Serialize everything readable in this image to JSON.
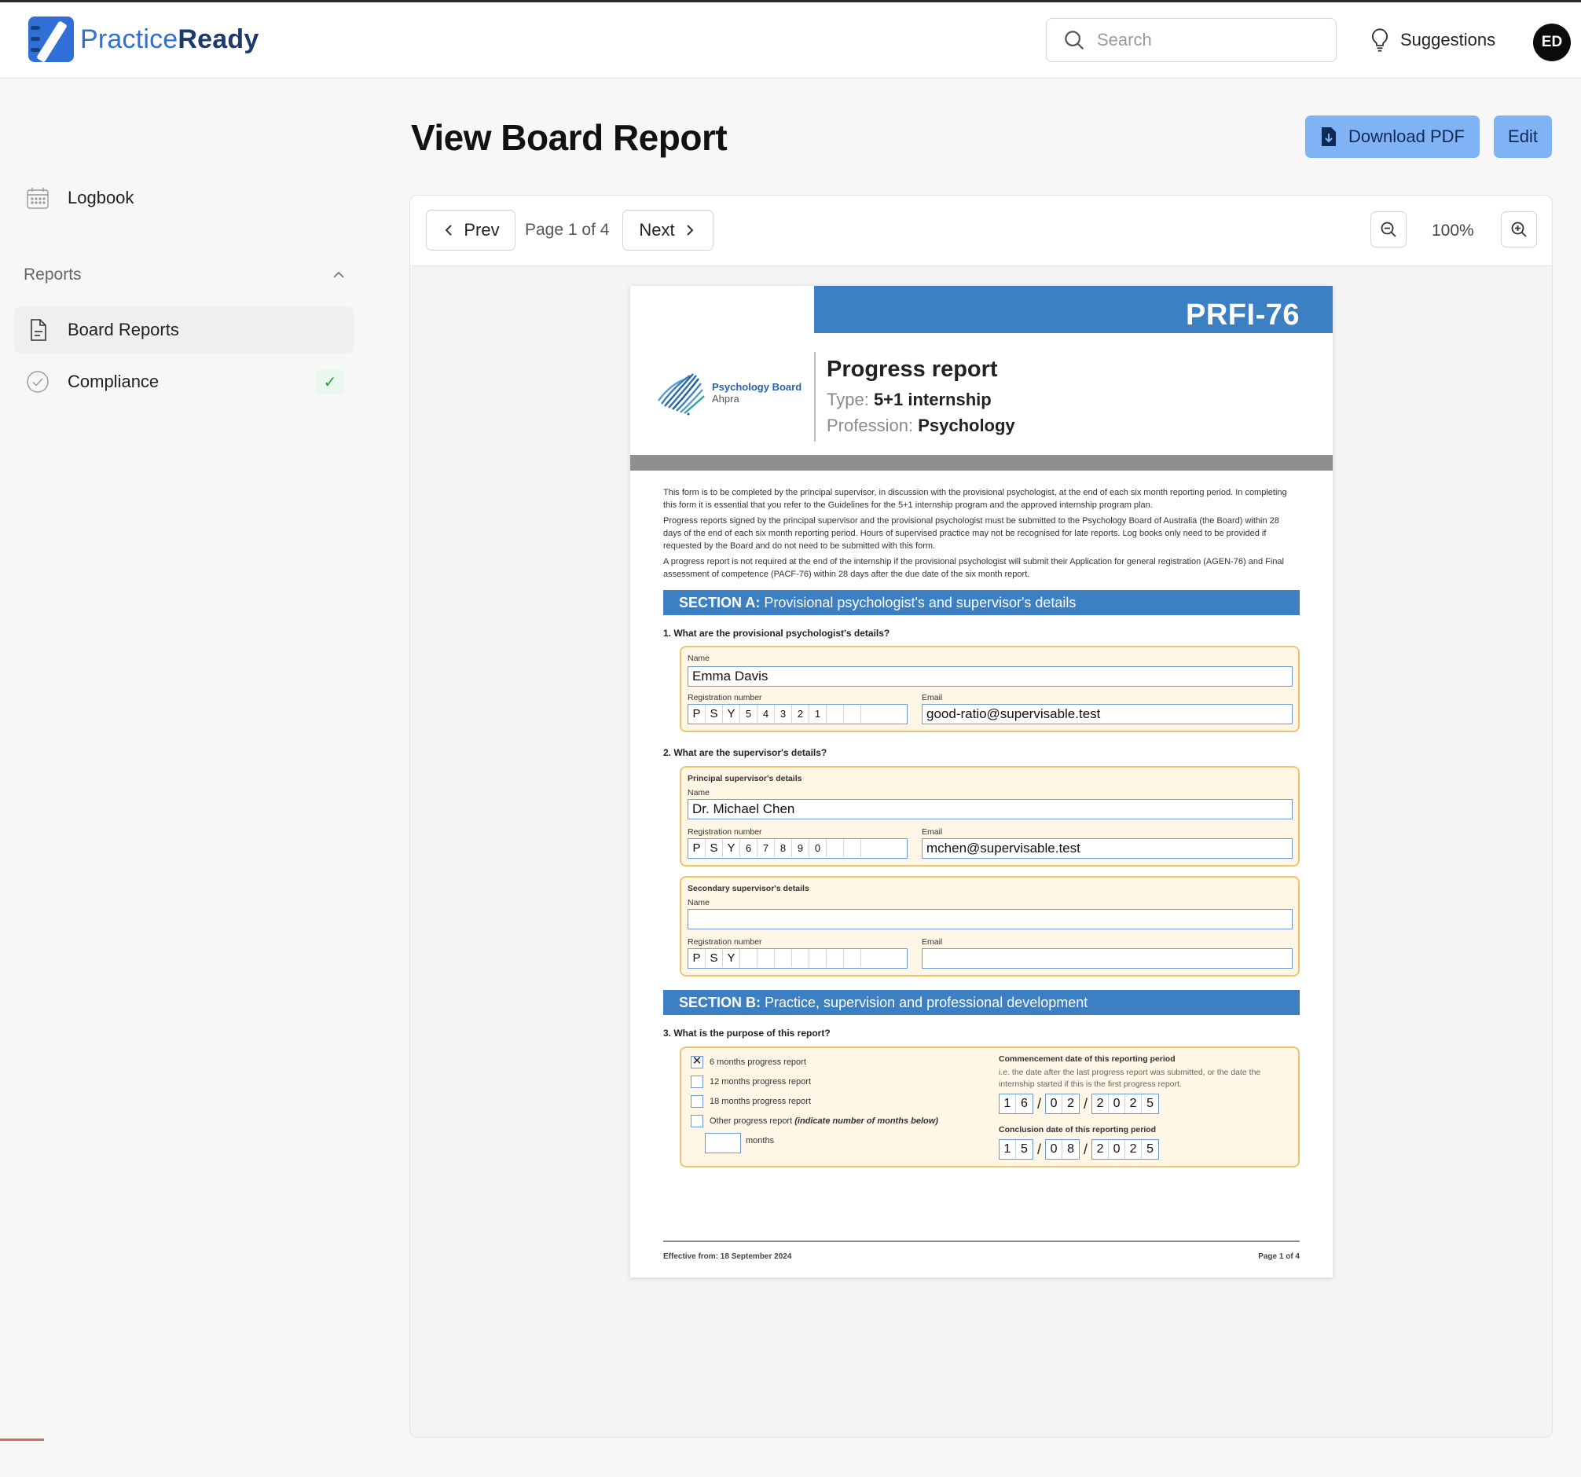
{
  "app": {
    "brand_light": "Practice",
    "brand_bold": "Ready",
    "search_placeholder": "Search",
    "suggestions_label": "Suggestions",
    "avatar_initials": "ED",
    "accent": "#2f6fd6"
  },
  "sidebar": {
    "logbook_label": "Logbook",
    "reports_section_label": "Reports",
    "items": [
      {
        "label": "Board Reports",
        "active": true
      },
      {
        "label": "Compliance",
        "badge": "✓"
      }
    ]
  },
  "main": {
    "title": "View Board Report",
    "download_label": "Download PDF",
    "edit_label": "Edit",
    "button_color": "#7fb3f5"
  },
  "viewer": {
    "prev_label": "Prev",
    "next_label": "Next",
    "page_indicator": "Page 1 of 4",
    "zoom_level": "100%"
  },
  "document": {
    "form_code": "PRFI-76",
    "brand_line1": "Psychology Board",
    "brand_line2": "Ahpra",
    "title": "Progress report",
    "type_label": "Type:",
    "type_value": "5+1 internship",
    "profession_label": "Profession:",
    "profession_value": "Psychology",
    "intro_p1": "This form is to be completed by the principal supervisor, in discussion with the provisional psychologist, at the end of each six month reporting period. In completing this form it is essential that you refer to the Guidelines for the 5+1 internship program and the approved internship program plan.",
    "intro_p2": "Progress reports signed by the principal supervisor and the provisional psychologist must be submitted to the Psychology Board of Australia (the Board) within 28 days of the end of each six month reporting period. Hours of supervised practice may not be recognised for late reports. Log books only need to be provided if requested by the Board and do not need to be submitted with this form.",
    "intro_p3": "A progress report is not required at the end of the internship if the provisional psychologist will submit their Application for general registration (AGEN-76) and Final assessment of competence (PACF-76) within 28 days after the due date of the six month report.",
    "section_a_bold": "SECTION A:",
    "section_a_rest": "Provisional psychologist's and supervisor's details",
    "q1": "1.   What are the provisional psychologist's details?",
    "q2": "2.   What are the supervisor's details?",
    "label_name": "Name",
    "label_reg": "Registration number",
    "label_email": "Email",
    "label_principal": "Principal supervisor's details",
    "label_secondary": "Secondary supervisor's details",
    "psych_name": "Emma Davis",
    "psych_reg": [
      "P",
      "S",
      "Y",
      "5",
      "4",
      "3",
      "2",
      "1",
      "",
      ""
    ],
    "psych_email": "good-ratio@supervisable.test",
    "sup_name": "Dr. Michael Chen",
    "sup_reg": [
      "P",
      "S",
      "Y",
      "6",
      "7",
      "8",
      "9",
      "0",
      "",
      ""
    ],
    "sup_email": "mchen@supervisable.test",
    "sec_reg": [
      "P",
      "S",
      "Y",
      "",
      "",
      "",
      "",
      "",
      "",
      ""
    ],
    "section_b_bold": "SECTION B:",
    "section_b_rest": "Practice, supervision and professional development",
    "q3": "3.   What is the purpose of this report?",
    "options": [
      {
        "label": "6 months progress report",
        "checked": true
      },
      {
        "label": "12 months progress report",
        "checked": false
      },
      {
        "label": "18 months progress report",
        "checked": false
      },
      {
        "label": "Other progress report",
        "suffix": "(indicate number of months below)",
        "checked": false
      }
    ],
    "months_label": "months",
    "commencement_label": "Commencement date of this reporting period",
    "commencement_hint": "i.e. the date after the last progress report was submitted, or the date the internship started if this is the first progress report.",
    "commencement_date": {
      "dd": [
        "1",
        "6"
      ],
      "mm": [
        "0",
        "2"
      ],
      "yyyy": [
        "2",
        "0",
        "2",
        "5"
      ]
    },
    "conclusion_label": "Conclusion date of this reporting period",
    "conclusion_date": {
      "dd": [
        "1",
        "5"
      ],
      "mm": [
        "0",
        "8"
      ],
      "yyyy": [
        "2",
        "0",
        "2",
        "5"
      ]
    },
    "footer_left": "Effective from: 18 September 2024",
    "footer_right": "Page 1 of 4",
    "band_color": "#3c7fc3"
  }
}
